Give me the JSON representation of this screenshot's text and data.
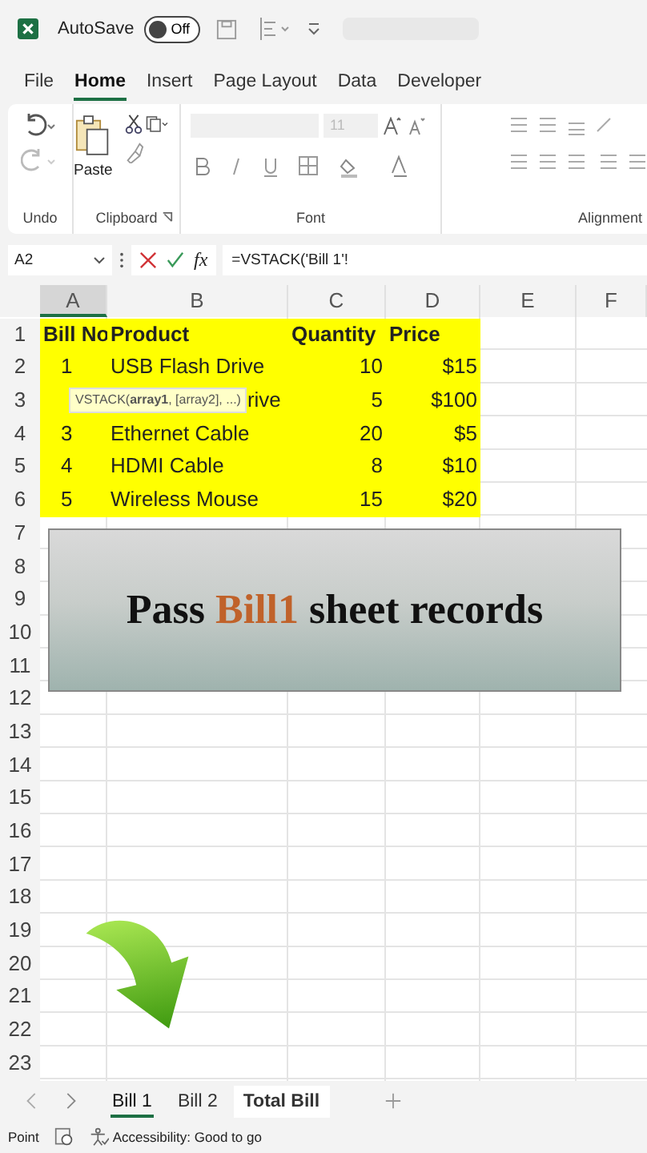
{
  "titlebar": {
    "autosave_label": "AutoSave",
    "autosave": {
      "on": false,
      "label": "Off"
    }
  },
  "ribbon_tabs": [
    {
      "label": "File",
      "selected": false
    },
    {
      "label": "Home",
      "selected": true
    },
    {
      "label": "Insert",
      "selected": false
    },
    {
      "label": "Page Layout",
      "selected": false
    },
    {
      "label": "Data",
      "selected": false
    },
    {
      "label": "Developer",
      "selected": false
    }
  ],
  "ribbon": {
    "groups": [
      {
        "kind": "undo",
        "label": "Undo"
      },
      {
        "kind": "clipboard",
        "label": "Clipboard",
        "paste_label": "Paste"
      },
      {
        "kind": "font",
        "label": "Font",
        "size": "11"
      },
      {
        "kind": "alignment",
        "label": "Alignment"
      }
    ]
  },
  "formula_bar": {
    "name_box": "A2",
    "fx": "fx",
    "formula": "=VSTACK('Bill 1'!"
  },
  "sheet": {
    "columns": [
      {
        "label": "A",
        "selected": true
      },
      {
        "label": "B",
        "selected": false
      },
      {
        "label": "C",
        "selected": false
      },
      {
        "label": "D",
        "selected": false
      },
      {
        "label": "E",
        "selected": false
      },
      {
        "label": "F",
        "selected": false
      }
    ],
    "row_numbers": [
      "1",
      "2",
      "3",
      "4",
      "5",
      "6",
      "7",
      "8",
      "9",
      "10",
      "11",
      "12",
      "13",
      "14",
      "15",
      "16",
      "17",
      "18",
      "19",
      "20",
      "21",
      "22",
      "23"
    ],
    "rows": [
      {
        "kind": "header",
        "bill_no": "Bill No",
        "product": "Product",
        "quantity": "Quantity",
        "price": "Price"
      },
      {
        "kind": "data",
        "bill_no": "1",
        "product": "USB Flash Drive",
        "quantity": "10",
        "price": "$15"
      },
      {
        "kind": "data",
        "tooltip": "VSTACK(**array1**, [array2], ...)",
        "product": "rive",
        "quantity": "5",
        "price": "$100"
      },
      {
        "kind": "data",
        "bill_no": "3",
        "product": "Ethernet Cable",
        "quantity": "20",
        "price": "$5"
      },
      {
        "kind": "data",
        "bill_no": "4",
        "product": "HDMI Cable",
        "quantity": "8",
        "price": "$10"
      },
      {
        "kind": "data",
        "bill_no": "5",
        "product": "Wireless Mouse",
        "quantity": "15",
        "price": "$20"
      }
    ]
  },
  "banner": {
    "text": "Pass **Bill1** sheet records"
  },
  "sheet_tabs": [
    {
      "label": "Bill 1",
      "selected": true,
      "bold": false
    },
    {
      "label": "Bill 2",
      "selected": false,
      "bold": false
    },
    {
      "label": "Total Bill",
      "selected": false,
      "bold": true
    }
  ],
  "status_bar": {
    "mode": "Point",
    "accessibility": "Accessibility: Good to go"
  }
}
